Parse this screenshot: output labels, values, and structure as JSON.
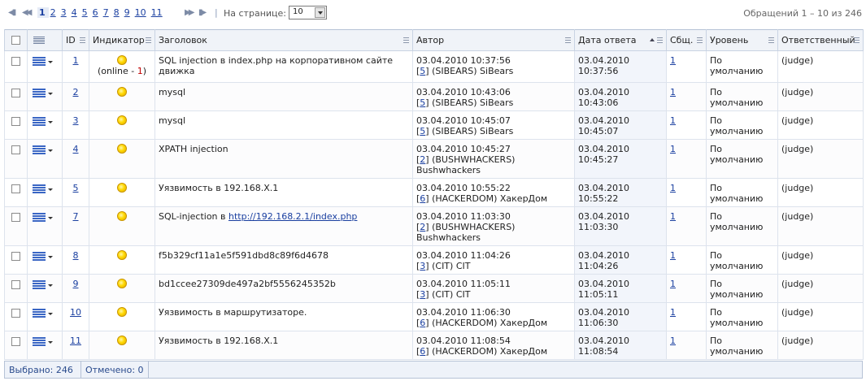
{
  "pager": {
    "first_icon": "first-page-icon",
    "prev_icon": "prev-page-icon",
    "next_icon": "next-page-icon",
    "last_icon": "last-page-icon",
    "pages": [
      "1",
      "2",
      "3",
      "4",
      "5",
      "6",
      "7",
      "8",
      "9",
      "10",
      "11"
    ],
    "current_page": "1",
    "per_page_label": "На странице:",
    "per_page_value": "10",
    "counter": "Обращений 1 – 10 из 246"
  },
  "columns": {
    "id": "ID",
    "indicator": "Индикатор",
    "title": "Заголовок",
    "author": "Автор",
    "reply_date": "Дата ответа",
    "messages": "Сбщ.",
    "level": "Уровень",
    "responsible": "Ответственный"
  },
  "rows": [
    {
      "id": "1",
      "indicator_note": "(online - ",
      "indicator_num": "1",
      "indicator_close": ")",
      "title": "SQL injection в index.php на корпоративном сайте движка",
      "title_link": "",
      "author_date": "03.04.2010 10:37:56",
      "author_team_id": "5",
      "author_team": "(SIBEARS) SiBears",
      "reply_date": "03.04.2010",
      "reply_time": "10:37:56",
      "messages": "1",
      "level": "По умолчанию",
      "responsible": "(judge)"
    },
    {
      "id": "2",
      "indicator_note": "",
      "indicator_num": "",
      "indicator_close": "",
      "title": "mysql",
      "title_link": "",
      "author_date": "03.04.2010 10:43:06",
      "author_team_id": "5",
      "author_team": "(SIBEARS) SiBears",
      "reply_date": "03.04.2010",
      "reply_time": "10:43:06",
      "messages": "1",
      "level": "По умолчанию",
      "responsible": "(judge)"
    },
    {
      "id": "3",
      "indicator_note": "",
      "indicator_num": "",
      "indicator_close": "",
      "title": "mysql",
      "title_link": "",
      "author_date": "03.04.2010 10:45:07",
      "author_team_id": "5",
      "author_team": "(SIBEARS) SiBears",
      "reply_date": "03.04.2010",
      "reply_time": "10:45:07",
      "messages": "1",
      "level": "По умолчанию",
      "responsible": "(judge)"
    },
    {
      "id": "4",
      "indicator_note": "",
      "indicator_num": "",
      "indicator_close": "",
      "title": "XPATH injection",
      "title_link": "",
      "author_date": "03.04.2010 10:45:27",
      "author_team_id": "2",
      "author_team": "(BUSHWHACKERS) Bushwhackers",
      "reply_date": "03.04.2010",
      "reply_time": "10:45:27",
      "messages": "1",
      "level": "По умолчанию",
      "responsible": "(judge)"
    },
    {
      "id": "5",
      "indicator_note": "",
      "indicator_num": "",
      "indicator_close": "",
      "title": "Уязвимость в 192.168.X.1",
      "title_link": "",
      "author_date": "03.04.2010 10:55:22",
      "author_team_id": "6",
      "author_team": "(HACKERDOM) ХакерДом",
      "reply_date": "03.04.2010",
      "reply_time": "10:55:22",
      "messages": "1",
      "level": "По умолчанию",
      "responsible": "(judge)"
    },
    {
      "id": "7",
      "indicator_note": "",
      "indicator_num": "",
      "indicator_close": "",
      "title": "SQL-injection в ",
      "title_link": "http://192.168.2.1/index.php",
      "author_date": "03.04.2010 11:03:30",
      "author_team_id": "2",
      "author_team": "(BUSHWHACKERS) Bushwhackers",
      "reply_date": "03.04.2010",
      "reply_time": "11:03:30",
      "messages": "1",
      "level": "По умолчанию",
      "responsible": "(judge)"
    },
    {
      "id": "8",
      "indicator_note": "",
      "indicator_num": "",
      "indicator_close": "",
      "title": "f5b329cf11a1e5f591dbd8c89f6d4678",
      "title_link": "",
      "author_date": "03.04.2010 11:04:26",
      "author_team_id": "3",
      "author_team": "(CIT) CIT",
      "reply_date": "03.04.2010",
      "reply_time": "11:04:26",
      "messages": "1",
      "level": "По умолчанию",
      "responsible": "(judge)"
    },
    {
      "id": "9",
      "indicator_note": "",
      "indicator_num": "",
      "indicator_close": "",
      "title": "bd1ccee27309de497a2bf5556245352b",
      "title_link": "",
      "author_date": "03.04.2010 11:05:11",
      "author_team_id": "3",
      "author_team": "(CIT) CIT",
      "reply_date": "03.04.2010",
      "reply_time": "11:05:11",
      "messages": "1",
      "level": "По умолчанию",
      "responsible": "(judge)"
    },
    {
      "id": "10",
      "indicator_note": "",
      "indicator_num": "",
      "indicator_close": "",
      "title": "Уязвимость в маршрутизаторе.",
      "title_link": "",
      "author_date": "03.04.2010 11:06:30",
      "author_team_id": "6",
      "author_team": "(HACKERDOM) ХакерДом",
      "reply_date": "03.04.2010",
      "reply_time": "11:06:30",
      "messages": "1",
      "level": "По умолчанию",
      "responsible": "(judge)"
    },
    {
      "id": "11",
      "indicator_note": "",
      "indicator_num": "",
      "indicator_close": "",
      "title": "Уязвимость в 192.168.X.1",
      "title_link": "",
      "author_date": "03.04.2010 11:08:54",
      "author_team_id": "6",
      "author_team": "(HACKERDOM) ХакерДом",
      "reply_date": "03.04.2010",
      "reply_time": "11:08:54",
      "messages": "1",
      "level": "По умолчанию",
      "responsible": "(judge)"
    }
  ],
  "footer": {
    "selected": "Выбрано: 246",
    "marked": "Отмечено: 0"
  },
  "colors": {
    "link": "#1a3fa0",
    "header_bg": "#f0f3f8",
    "indicator": "#ffd800",
    "online_count": "#c00000"
  }
}
